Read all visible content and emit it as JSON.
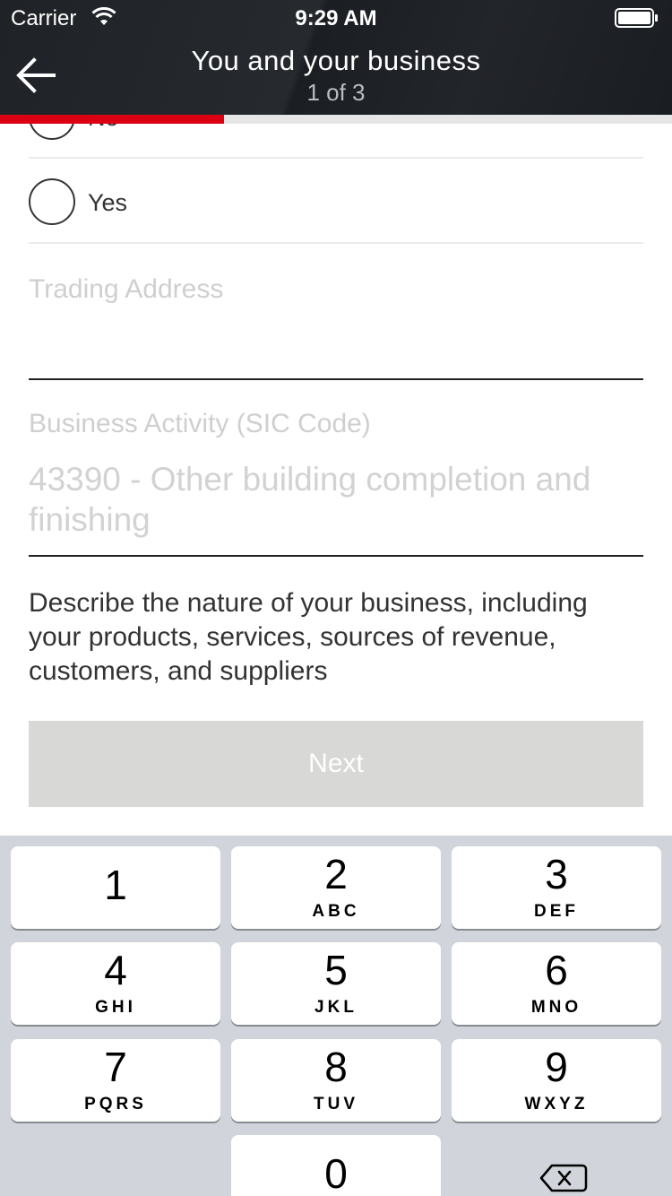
{
  "status_bar": {
    "carrier": "Carrier",
    "time": "9:29 AM"
  },
  "nav": {
    "title": "You and your business",
    "subtitle": "1 of 3"
  },
  "progress": {
    "fraction": 0.333,
    "color": "#db0011"
  },
  "form": {
    "radio_options": [
      {
        "label": "No",
        "selected": false
      },
      {
        "label": "Yes",
        "selected": false
      }
    ],
    "trading_address": {
      "label": "Trading Address",
      "value": ""
    },
    "business_activity": {
      "label": "Business Activity (SIC Code)",
      "value": "43390 - Other building completion and finishing"
    },
    "nature_question": "Describe the nature of your business, including your products, services, sources of revenue, customers, and suppliers",
    "next_label": "Next"
  },
  "keypad": {
    "keys": [
      {
        "digit": "1",
        "letters": ""
      },
      {
        "digit": "2",
        "letters": "ABC"
      },
      {
        "digit": "3",
        "letters": "DEF"
      },
      {
        "digit": "4",
        "letters": "GHI"
      },
      {
        "digit": "5",
        "letters": "JKL"
      },
      {
        "digit": "6",
        "letters": "MNO"
      },
      {
        "digit": "7",
        "letters": "PQRS"
      },
      {
        "digit": "8",
        "letters": "TUV"
      },
      {
        "digit": "9",
        "letters": "WXYZ"
      },
      {
        "digit": "0",
        "letters": ""
      }
    ]
  },
  "colors": {
    "brand_red": "#db0011",
    "header_bg": "#1f2226",
    "button_disabled": "#d8d8d6",
    "keyboard_bg": "#d1d4da"
  }
}
